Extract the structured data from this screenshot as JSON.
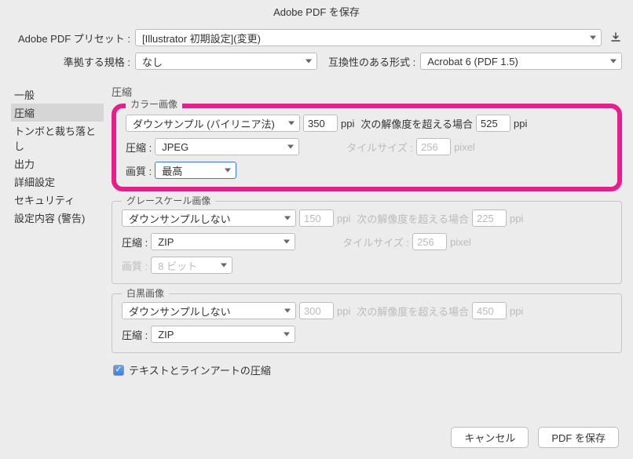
{
  "title": "Adobe PDF を保存",
  "top": {
    "preset_label": "Adobe PDF プリセット :",
    "preset_value": "[Illustrator 初期設定](変更)",
    "standard_label": "準拠する規格 :",
    "standard_value": "なし",
    "compat_label": "互換性のある形式 :",
    "compat_value": "Acrobat 6 (PDF 1.5)"
  },
  "sidebar": {
    "items": [
      "一般",
      "圧縮",
      "トンボと裁ち落とし",
      "出力",
      "詳細設定",
      "セキュリティ",
      "設定内容 (警告)"
    ],
    "selected_index": 1
  },
  "content_title": "圧縮",
  "color": {
    "legend": "カラー画像",
    "downsample": "ダウンサンプル (バイリニア法)",
    "ppi1": "350",
    "ppi1_unit": "ppi",
    "exceed_label": "次の解像度を超える場合",
    "ppi2": "525",
    "ppi2_unit": "ppi",
    "compress_label": "圧縮 :",
    "compress_value": "JPEG",
    "tile_label": "タイルサイズ :",
    "tile_value": "256",
    "tile_unit": "pixel",
    "quality_label": "画質 :",
    "quality_value": "最高"
  },
  "gray": {
    "legend": "グレースケール画像",
    "downsample": "ダウンサンプルしない",
    "ppi1": "150",
    "ppi1_unit": "ppi",
    "exceed_label": "次の解像度を超える場合",
    "ppi2": "225",
    "ppi2_unit": "ppi",
    "compress_label": "圧縮 :",
    "compress_value": "ZIP",
    "tile_label": "タイルサイズ :",
    "tile_value": "256",
    "tile_unit": "pixel",
    "quality_label": "画質 :",
    "quality_value": "8 ビット"
  },
  "mono": {
    "legend": "白黒画像",
    "downsample": "ダウンサンプルしない",
    "ppi1": "300",
    "ppi1_unit": "ppi",
    "exceed_label": "次の解像度を超える場合",
    "ppi2": "450",
    "ppi2_unit": "ppi",
    "compress_label": "圧縮 :",
    "compress_value": "ZIP"
  },
  "checkbox_label": "テキストとラインアートの圧縮",
  "buttons": {
    "cancel": "キャンセル",
    "save": "PDF を保存"
  }
}
